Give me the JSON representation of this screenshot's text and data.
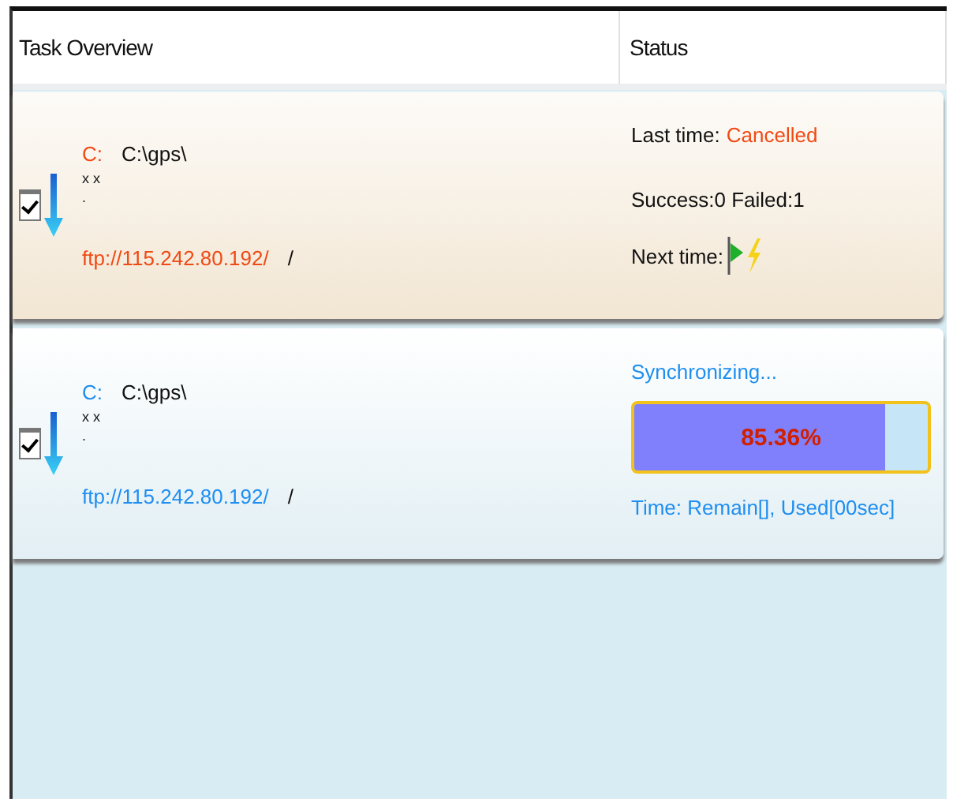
{
  "table": {
    "columns": [
      "Task Overview",
      "Status"
    ],
    "rows": [
      {
        "kind": "finished",
        "checked": true,
        "drive": "C:",
        "local_path": "C:\\gps\\",
        "name_1": "x x",
        "name_2": ".",
        "remote": "ftp://115.242.80.192/",
        "remote_dir": "/",
        "last_time_label": "Last time:",
        "last_time_value": "Cancelled",
        "counts": "Success:0 Failed:1",
        "next_time_label": "Next time:"
      },
      {
        "kind": "syncing",
        "checked": true,
        "drive": "C:",
        "local_path": "C:\\gps\\",
        "name_1": "x x",
        "name_2": ".",
        "remote": "ftp://115.242.80.192/",
        "remote_dir": "/",
        "status": "Synchronizing...",
        "level": 0.8536,
        "percent": "85.36%",
        "time": "Time: Remain[], Used[00sec]"
      }
    ]
  }
}
